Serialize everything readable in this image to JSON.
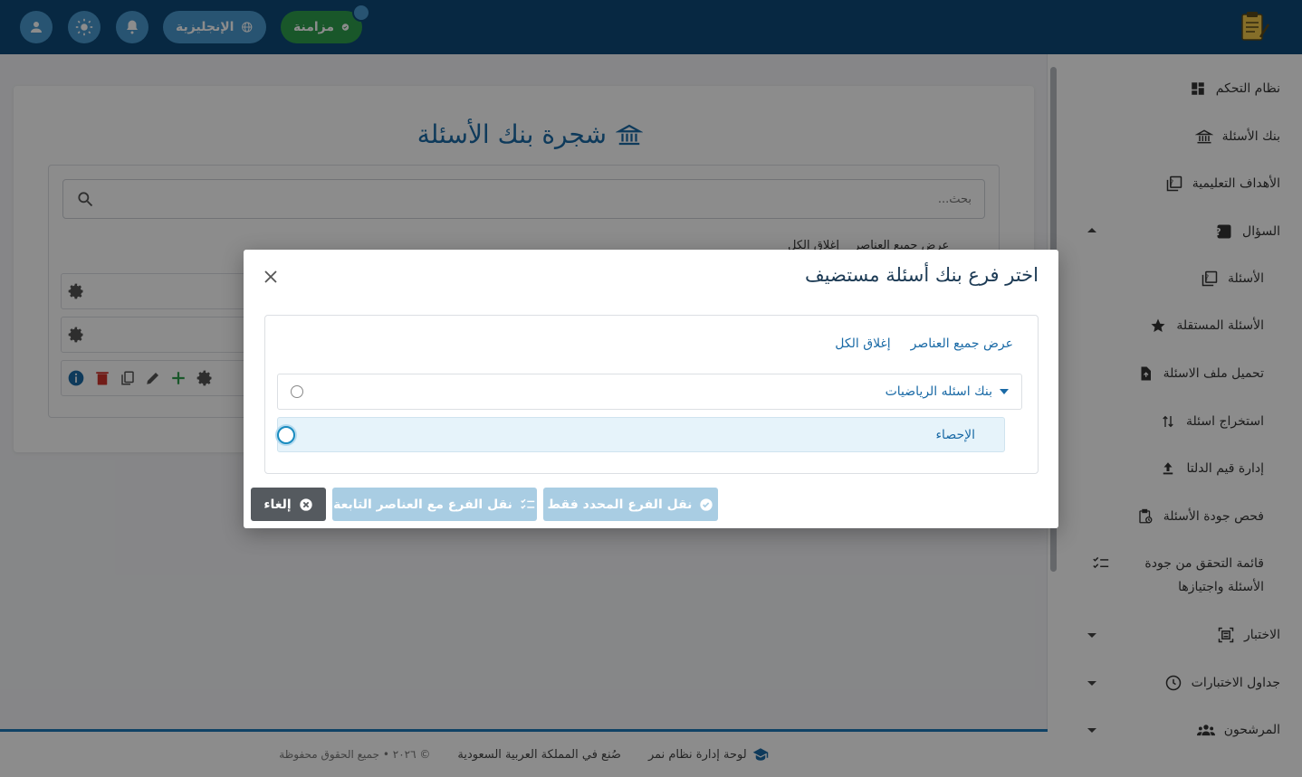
{
  "topbar": {
    "sync_label": "مزامنة",
    "language_label": "الإنجليزية",
    "accent": "#4a9ad0",
    "bar_color": "#0e4a78"
  },
  "sidebar": {
    "items": [
      {
        "label": "نظام التحكم",
        "icon": "dashboard-icon"
      },
      {
        "label": "بنك الأسئلة",
        "icon": "bank-icon"
      },
      {
        "label": "الأهداف التعليمية",
        "icon": "objectives-icon"
      },
      {
        "label": "السؤال",
        "icon": "question-icon",
        "expanded": true
      },
      {
        "label": "الأسئلة",
        "icon": "questions-icon"
      },
      {
        "label": "الأسئلة المستقلة",
        "icon": "star-icon"
      },
      {
        "label": "تحميل ملف الاسئلة",
        "icon": "upload-file-icon"
      },
      {
        "label": "استخراج اسئلة",
        "icon": "export-icon"
      },
      {
        "label": "إدارة قيم الدلتا",
        "icon": "upload-icon"
      },
      {
        "label": "فحص جودة الأسئلة",
        "icon": "clipboard-check-icon"
      },
      {
        "label": "قائمة التحقق من جودة الأسئلة واجتيازها",
        "icon": "checklist-icon"
      },
      {
        "label": "الاختبار",
        "icon": "exam-icon"
      },
      {
        "label": "جداول الاختبارات",
        "icon": "clock-icon"
      },
      {
        "label": "المرشحون",
        "icon": "people-icon"
      }
    ]
  },
  "main": {
    "title": "شجرة بنك الأسئلة",
    "search_placeholder": "بحث...",
    "expand_all": "عرض جميع العناصر",
    "collapse_all": "إغلاق الكل"
  },
  "modal": {
    "title": "اختر فرع بنك أسئلة مستضيف",
    "expand_all": "عرض جميع العناصر",
    "collapse_all": "إغلاق الكل",
    "tree": {
      "root": "بنك اسئله الرياضيات",
      "child": "الإحصاء"
    },
    "buttons": {
      "move_only": "نقل الفرع المحدد فقط",
      "move_with_children": "نقل الفرع مع العناصر التابعة",
      "cancel": "إلغاء"
    }
  },
  "footer": {
    "brand": "لوحة إدارة نظام نمر",
    "made_in": "صُنع في المملكة العربية السعودية",
    "copyright": "© ٢٠٢٦ • جميع الحقوق محفوظة"
  }
}
